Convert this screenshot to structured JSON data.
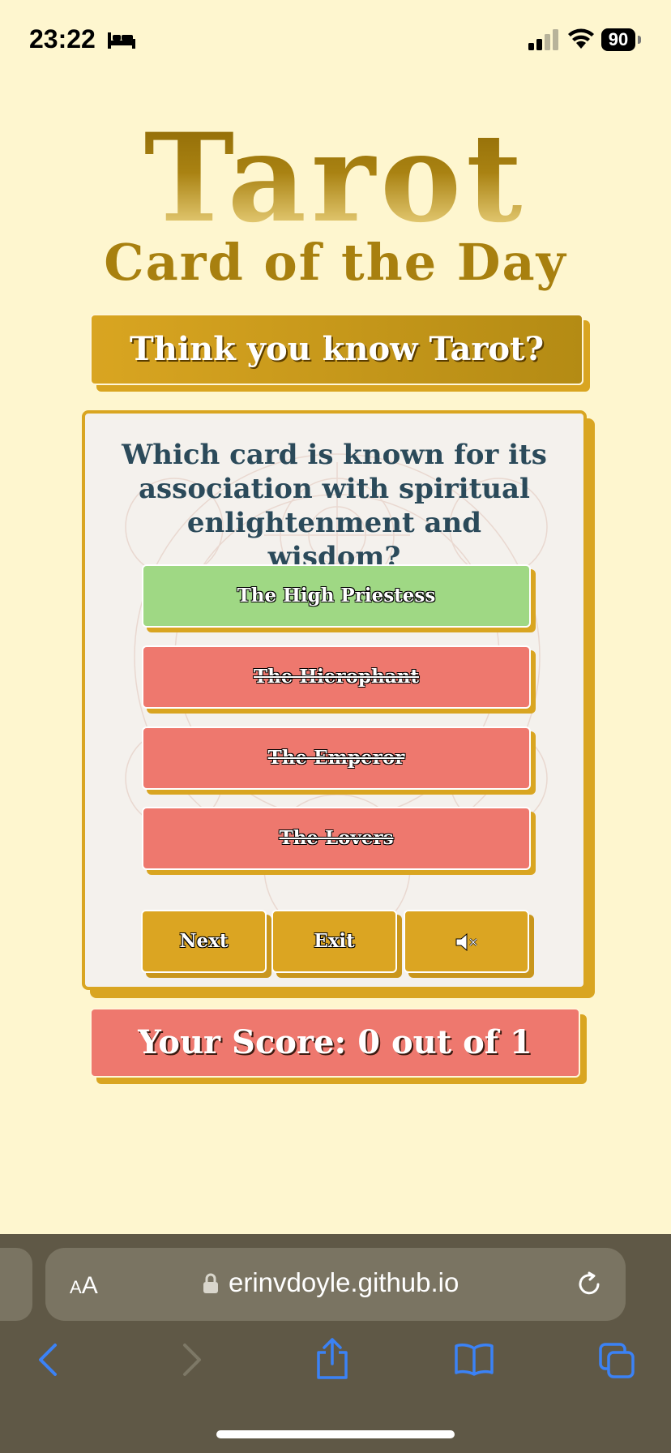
{
  "status_bar": {
    "time": "23:22",
    "battery": "90"
  },
  "title": {
    "main": "Tarot",
    "sub": "Card of the Day"
  },
  "banner": {
    "text": "Think you know Tarot?"
  },
  "quiz": {
    "question": "Which card is known for its association with spiritual enlightenment and wisdom?",
    "answers": [
      {
        "label": "The High Priestess",
        "state": "correct"
      },
      {
        "label": "The Hierophant",
        "state": "wrong"
      },
      {
        "label": "The Emperor",
        "state": "wrong"
      },
      {
        "label": "The Lovers",
        "state": "wrong"
      }
    ],
    "controls": {
      "next": "Next",
      "exit": "Exit",
      "mute_icon": "speaker-muted-icon"
    }
  },
  "score": {
    "text": "Your Score: 0 out of 1"
  },
  "browser": {
    "aa_small": "A",
    "aa_large": "A",
    "url": "erinvdoyle.github.io"
  },
  "colors": {
    "background": "#fef6cf",
    "gold": "#d9a521",
    "correct": "#9fd884",
    "wrong": "#ee786e",
    "question_text": "#2b4a5a"
  }
}
